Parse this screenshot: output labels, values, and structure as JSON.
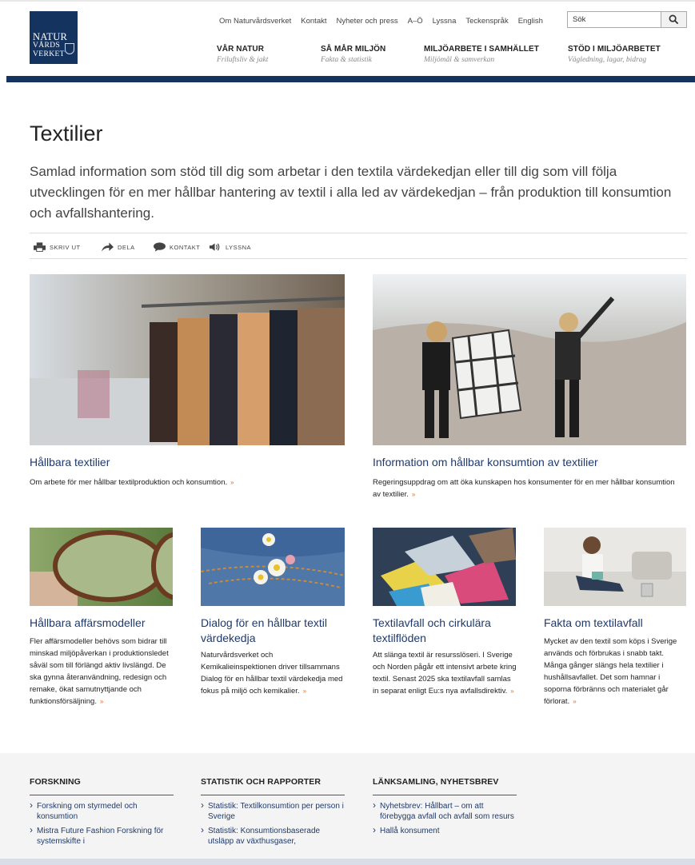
{
  "logo": {
    "line1": "NATUR",
    "line2": "VÅRDS",
    "line3": "VERKET"
  },
  "utility_links": [
    "Om Naturvårdsverket",
    "Kontakt",
    "Nyheter och press",
    "A–Ö",
    "Lyssna",
    "Teckenspråk",
    "English"
  ],
  "search": {
    "value": "Sök"
  },
  "nav": [
    {
      "title": "VÅR NATUR",
      "sub": "Friluftsliv & jakt"
    },
    {
      "title": "SÅ MÅR MILJÖN",
      "sub": "Fakta & statistik"
    },
    {
      "title": "MILJÖARBETE I SAMHÄLLET",
      "sub": "Miljömål & samverkan"
    },
    {
      "title": "STÖD I MILJÖARBETET",
      "sub": "Vägledning, lagar, bidrag"
    }
  ],
  "page": {
    "title": "Textilier",
    "intro": "Samlad information som stöd till dig som arbetar i den textila värdekedjan eller till dig som vill följa utvecklingen för en mer hållbar hantering av textil i alla led av värdekedjan – från produktion till konsumtion och avfallshantering."
  },
  "tools": [
    "SKRIV UT",
    "DELA",
    "KONTAKT",
    "LYSSNA"
  ],
  "cards": [
    {
      "title": "Hållbara textilier",
      "desc": "Om arbete för mer hållbar textilproduktion och konsumtion.",
      "more": "»"
    },
    {
      "title": "Information om hållbar konsumtion av textilier",
      "desc": "Regeringsuppdrag om att öka kunskapen hos konsumenter för en mer hållbar konsumtion av textilier.",
      "more": "»"
    },
    {
      "title": "Hållbara affärsmodeller",
      "desc": "Fler affärsmodeller behövs som bidrar till minskad miljöpåverkan i produktionsledet såväl som till förlängd aktiv livslängd. De ska gynna återanvändning, redesign och remake, ökat samutnyttjande och funktionsförsäljning.",
      "more": "»"
    },
    {
      "title": "Dialog för en hållbar textil värdekedja",
      "desc": "Naturvårdsverket och Kemikalieinspektionen driver tillsammans Dialog för en hållbar textil värdekedja med fokus på miljö och kemikalier.",
      "more": "»"
    },
    {
      "title": "Textilavfall och cirkulära textilflöden",
      "desc": "Att slänga textil är resursslöseri. I Sverige och Norden pågår ett intensivt arbete kring textil. Senast 2025 ska textilavfall samlas in separat enligt Eu:s nya avfallsdirektiv.",
      "more": "»"
    },
    {
      "title": "Fakta om textilavfall",
      "desc": "Mycket av den textil som köps i Sverige används och förbrukas i snabb takt. Många gånger slängs hela textilier i hushållsavfallet. Det som hamnar i soporna förbränns och materialet går förlorat.",
      "more": "»"
    }
  ],
  "footer": [
    {
      "heading": "FORSKNING",
      "links": [
        "Forskning om styrmedel och konsumtion",
        "Mistra Future Fashion Forskning för systemskifte i"
      ]
    },
    {
      "heading": "STATISTIK OCH RAPPORTER",
      "links": [
        "Statistik: Textilkonsumtion per person i Sverige",
        "Statistik: Konsumtionsbaserade utsläpp av växthusgaser,"
      ]
    },
    {
      "heading": "LÄNKSAMLING, NYHETSBREV",
      "links": [
        "Nyhetsbrev: Hållbart – om att förebygga avfall och avfall som resurs",
        "Hallå konsument"
      ]
    }
  ]
}
